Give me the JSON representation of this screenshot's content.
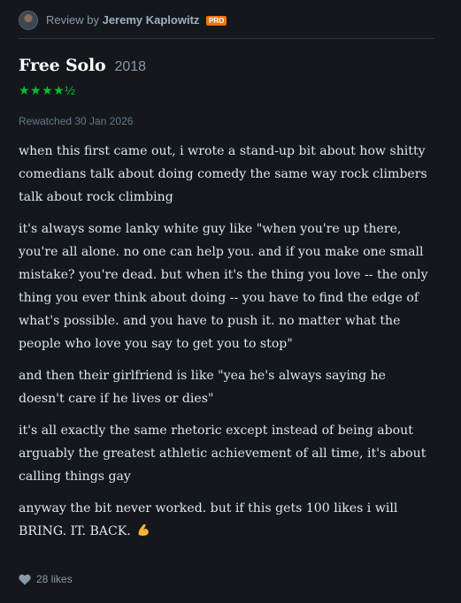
{
  "reviewer": {
    "prefix": "Review by",
    "name": "Jeremy Kaplowitz",
    "badge": "PRO"
  },
  "film": {
    "title": "Free Solo",
    "year": "2018",
    "rating_text": "★★★★½",
    "rating_value": 4.5,
    "rating_color": "#00c030"
  },
  "activity": {
    "rewatched": "Rewatched 30 Jan 2026"
  },
  "review": {
    "paragraphs": [
      "when this first came out, i wrote a stand-up bit about how shitty comedians talk about doing comedy the same way rock climbers talk about rock climbing",
      "it's always some lanky white guy like \"when you're up there, you're all alone. no one can help you. and if you make one small mistake? you're dead. but when it's the thing you love -- the only thing you ever think about doing -- you have to find the edge of what's possible. and you have to push it. no matter what the people who love you say to get you to stop\"",
      "and then their girlfriend is like \"yea he's always saying he doesn't care if he lives or dies\"",
      "it's all exactly the same rhetoric except instead of being about arguably the greatest athletic achievement of all time, it's about calling things gay",
      "anyway the bit never worked. but if this gets 100 likes i will BRING. IT. BACK."
    ],
    "emoji_icon": "flexed-biceps-icon"
  },
  "likes": {
    "label": "28 likes",
    "icon": "heart-icon"
  },
  "colors": {
    "background": "#14181c",
    "pro_badge": "#f27405",
    "stars": "#00c030",
    "title": "#ffffff",
    "body": "#dde6ed"
  }
}
